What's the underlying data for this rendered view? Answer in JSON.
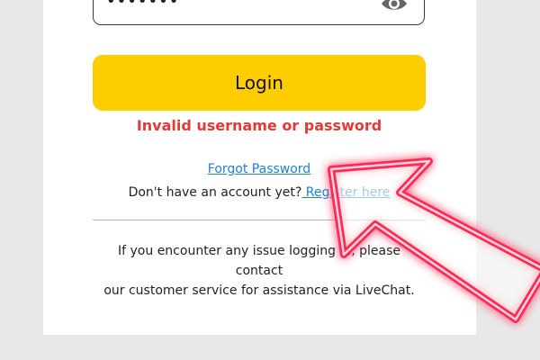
{
  "password": {
    "masked_value": "•••••••",
    "icon": "eye-icon"
  },
  "login": {
    "button_label": "Login",
    "error_message": "Invalid username or password"
  },
  "links": {
    "forgot_password": "Forgot Password",
    "no_account_prompt": "Don't have an account yet?",
    "register_label": " Register here"
  },
  "help": {
    "line1": "If you encounter any issue logging in, please contact",
    "line2": "our customer service for assistance via LiveChat."
  },
  "overlay": {
    "icon": "pointer-arrow-icon",
    "color": "#ff2a55"
  },
  "colors": {
    "accent": "#fecd00",
    "error": "#e53935",
    "link": "#1e7fd6"
  }
}
